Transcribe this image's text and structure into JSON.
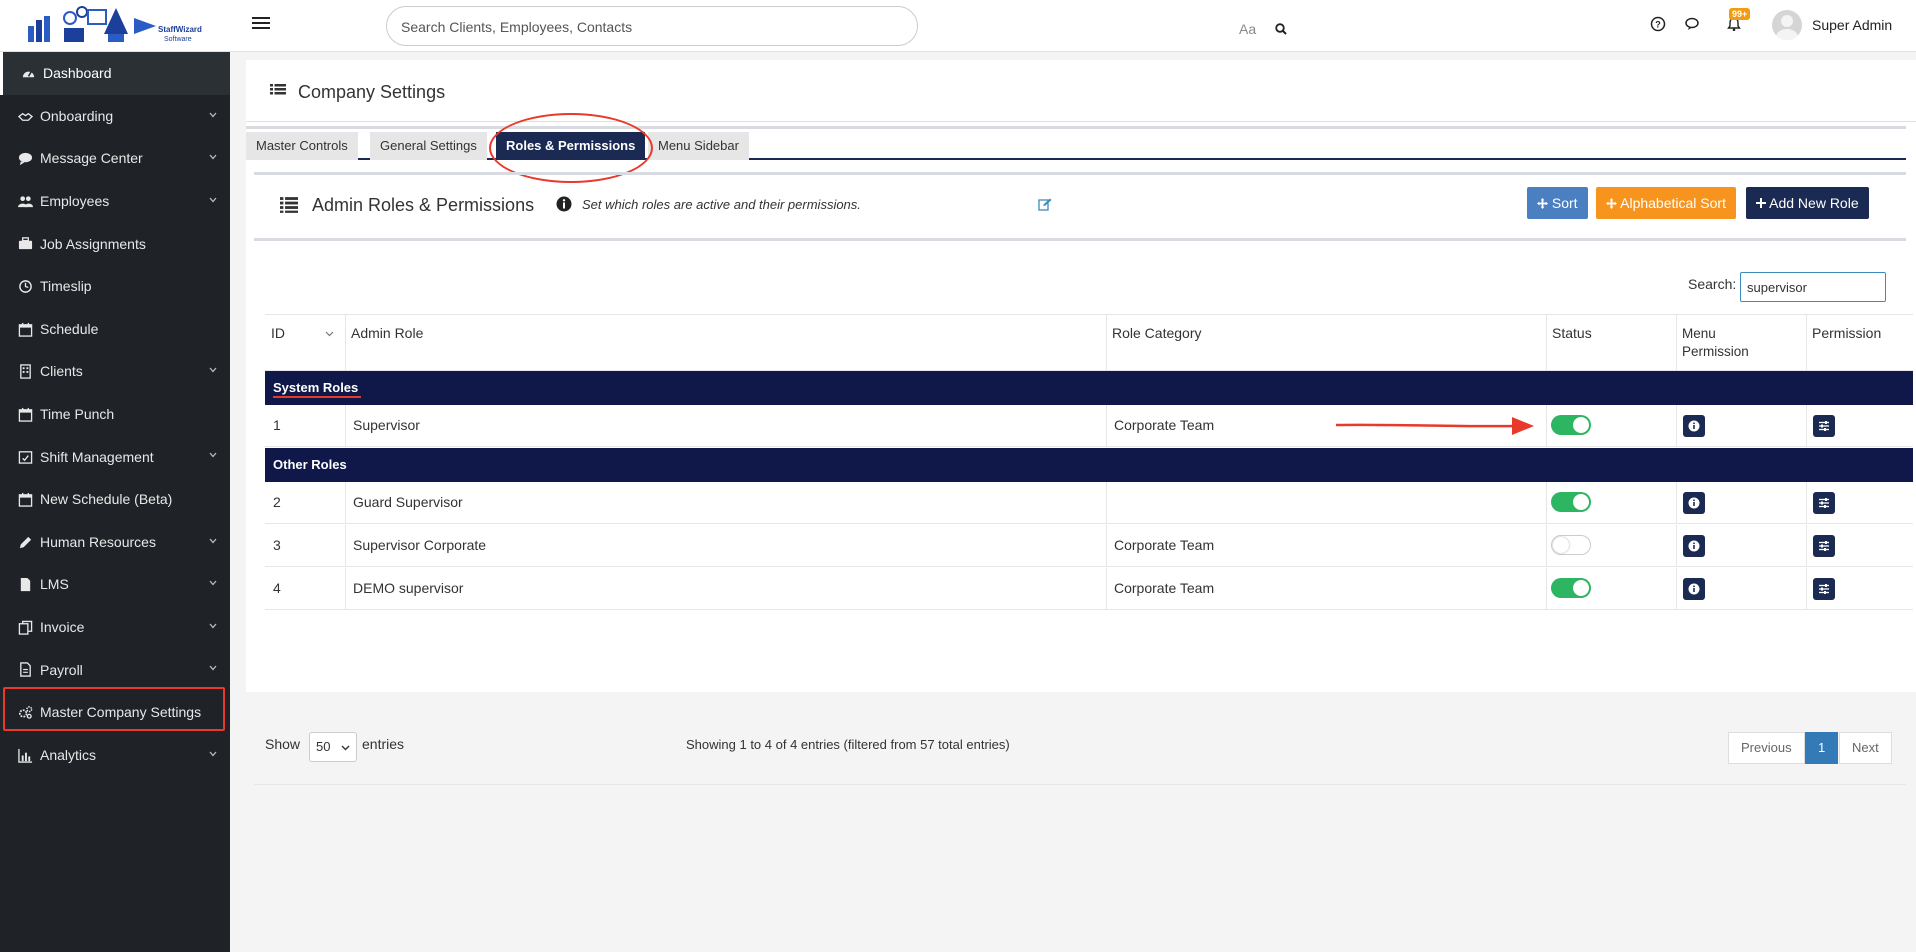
{
  "header": {
    "logo_text": "StaffWizard Software",
    "search_placeholder": "Search Clients, Employees, Contacts",
    "aa_label": "Aa",
    "notification_badge": "99+",
    "user_name": "Super Admin"
  },
  "sidebar": {
    "items": [
      {
        "label": "Dashboard",
        "icon": "dashboard-icon",
        "active": true,
        "chevron": false
      },
      {
        "label": "Onboarding",
        "icon": "handshake-icon",
        "chevron": true
      },
      {
        "label": "Message Center",
        "icon": "chat-icon",
        "chevron": true
      },
      {
        "label": "Employees",
        "icon": "users-icon",
        "chevron": true
      },
      {
        "label": "Job Assignments",
        "icon": "briefcase-icon",
        "chevron": false
      },
      {
        "label": "Timeslip",
        "icon": "clock-icon",
        "chevron": false
      },
      {
        "label": "Schedule",
        "icon": "calendar-icon",
        "chevron": false
      },
      {
        "label": "Clients",
        "icon": "building-icon",
        "chevron": true
      },
      {
        "label": "Time Punch",
        "icon": "calendar-icon",
        "chevron": false
      },
      {
        "label": "Shift Management",
        "icon": "calendar-check-icon",
        "chevron": true
      },
      {
        "label": "New Schedule (Beta)",
        "icon": "calendar-icon",
        "chevron": false
      },
      {
        "label": "Human Resources",
        "icon": "pencil-icon",
        "chevron": true
      },
      {
        "label": "LMS",
        "icon": "file-icon",
        "chevron": true
      },
      {
        "label": "Invoice",
        "icon": "copy-icon",
        "chevron": true
      },
      {
        "label": "Payroll",
        "icon": "document-icon",
        "chevron": true
      },
      {
        "label": "Master Company Settings",
        "icon": "gears-icon",
        "chevron": false
      },
      {
        "label": "Analytics",
        "icon": "bar-chart-icon",
        "chevron": true
      }
    ]
  },
  "page": {
    "title": "Company Settings",
    "tabs": [
      "Master Controls",
      "General Settings",
      "Roles & Permissions",
      "Menu Sidebar"
    ],
    "active_tab": "Roles & Permissions"
  },
  "panel": {
    "title": "Admin Roles & Permissions",
    "description": "Set which roles are active and their permissions.",
    "buttons": {
      "sort": "Sort",
      "alpha_sort": "Alphabetical Sort",
      "add_role": "Add New Role"
    },
    "search_label": "Search:",
    "search_value": "supervisor"
  },
  "table": {
    "columns": [
      "ID",
      "Admin Role",
      "Role Category",
      "Status",
      "Menu Permission",
      "Permission"
    ],
    "menu_permission_lines": [
      "Menu",
      "Permission"
    ],
    "groups": [
      {
        "label": "System Roles",
        "rows": [
          {
            "id": "1",
            "role": "Supervisor",
            "category": "Corporate Team",
            "status_on": true
          }
        ]
      },
      {
        "label": "Other Roles",
        "rows": [
          {
            "id": "2",
            "role": "Guard Supervisor",
            "category": "",
            "status_on": true
          },
          {
            "id": "3",
            "role": "Supervisor Corporate",
            "category": "Corporate Team",
            "status_on": false
          },
          {
            "id": "4",
            "role": "DEMO supervisor",
            "category": "Corporate Team",
            "status_on": true
          }
        ]
      }
    ]
  },
  "footer": {
    "show_label": "Show",
    "entries_value": "50",
    "entries_label": "entries",
    "showing_text": "Showing 1 to 4 of 4 entries (filtered from 57 total entries)",
    "prev": "Previous",
    "page": "1",
    "next": "Next"
  },
  "colors": {
    "sidebar_bg": "#1f2327",
    "navy": "#1a2a52",
    "group_bg": "#0f1848",
    "toggle_on": "#2db562",
    "highlight_red": "#e8392b",
    "sort_blue": "#4a7fc1",
    "alpha_orange": "#f7941d"
  }
}
